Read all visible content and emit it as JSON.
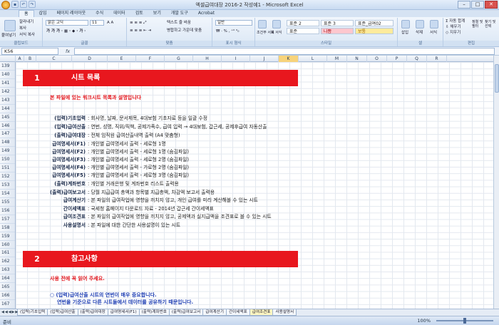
{
  "window": {
    "title": "엑셀급여대장 2016-2 작성예1 - Microsoft Excel"
  },
  "ribbon_tabs": [
    "홈",
    "삽입",
    "페이지 레이아웃",
    "수식",
    "데이터",
    "검토",
    "보기",
    "개발 도구",
    "Acrobat"
  ],
  "ribbon": {
    "clipboard": {
      "paste": "붙여넣기",
      "cut": "잘라내기",
      "copy": "복사",
      "format_painter": "서식 복사",
      "label": "클립보드"
    },
    "font": {
      "name": "맑은 고딕",
      "size": "11",
      "label": "글꼴"
    },
    "alignment": {
      "wrap": "텍스트 줄 바꿈",
      "merge": "병합하고 가운데 맞춤",
      "label": "맞춤"
    },
    "number": {
      "format": "일반",
      "label": "표시 형식"
    },
    "styles": {
      "cond": "조건부 서식",
      "table": "표 서식",
      "s1": "표준 2",
      "s2": "표준 3",
      "s3": "표준_급여02",
      "s4": "표준",
      "s5": "나쁨",
      "s6": "보통",
      "label": "스타일"
    },
    "cells": {
      "insert": "삽입",
      "delete": "삭제",
      "format": "서식",
      "label": "셀"
    },
    "editing": {
      "autosum": "자동 합계",
      "fill": "채우기",
      "clear": "지우기",
      "sort": "정렬 및 필터",
      "find": "찾기 및 선택",
      "label": "편집"
    }
  },
  "formula_bar": {
    "cell_ref": "K56",
    "fx": "fx"
  },
  "columns": [
    "A",
    "B",
    "C",
    "D",
    "E",
    "F",
    "G",
    "H",
    "I",
    "J",
    "K",
    "L",
    "M",
    "N",
    "O",
    "P",
    "Q",
    "R"
  ],
  "selected_column": "K",
  "rows": [
    "139",
    "140",
    "141",
    "142",
    "143",
    "144",
    "145",
    "146",
    "147",
    "148",
    "149",
    "150",
    "151",
    "152",
    "153",
    "154",
    "155",
    "156",
    "157",
    "158",
    "159",
    "160",
    "161",
    "162",
    "163",
    "164",
    "165",
    "166",
    "167"
  ],
  "section1": {
    "number": "1",
    "title": "시트 목록",
    "subtitle": "본 파일에 있는 워크시트 목록과 설명입니다"
  },
  "sheet_list": [
    {
      "label": "(입력)기초입력",
      "desc": ": 회사명, 날짜, 문서제목, 4대보험 기초자료 등을 일괄 수정"
    },
    {
      "label": "(입력)급여산출",
      "desc": ": 연번, 성명, 직위/직책, 공제가족수, 급여 입력 → 4대보험, 갑근세, 공제후급여 자동산출"
    },
    {
      "label": "(출력)급여대장",
      "desc": ": 전체 임직원 급여산출내역 출력 (A4 맞춤형)"
    },
    {
      "label": "급여명세서(F1)",
      "desc": ": 개인별 급여명세서 출력 - 세로형 1명"
    },
    {
      "label": "급여명세서(F2)",
      "desc": ": 개인별 급여명세서 출력 - 세로형 1명       (숨김파일)"
    },
    {
      "label": "급여명세서(F3)",
      "desc": ": 개인별 급여명세서 출력 - 세로형 2명       (숨김파일)"
    },
    {
      "label": "급여명세서(F4)",
      "desc": ": 개인별 급여명세서 출력 - 가로형 2명       (숨김파일)"
    },
    {
      "label": "급여명세서(F5)",
      "desc": ": 개인별 급여명세서 출력 - 세로형 3명       (숨김파일)"
    },
    {
      "label": "(출력)계좌번호",
      "desc": ": 개인별 거래은행 및 계좌번호 리스트 출력용"
    },
    {
      "label": "(출력)급여보고서",
      "desc": ": 당월 지급급여 총액과 항목별 지급총액, 차감액 보고서 출력용"
    },
    {
      "label": "급여계산기",
      "desc": ": 본 파일의 급여작업에 영향을 끼치지 않고, 개인 급여를 미리 계산해볼 수 있는 시트"
    },
    {
      "label": "간이세액표",
      "desc": ": 국세청 홈페이지 다운로드 자료 - 2014년 갑근세 간이세액표"
    },
    {
      "label": "급여조견표",
      "desc": ": 본 파일의 급여작업에 영향을 끼치지 않고, 공제액과 실지급액을 조견표로 볼 수 있는 시트"
    },
    {
      "label": "사용설명서",
      "desc": ": 본 파일에 대한 간단한 사용설명이 있는 시트"
    }
  ],
  "section2": {
    "number": "2",
    "title": "참고사항",
    "subtitle": "사용 전에 꼭 읽어 주세요.",
    "note1": "○ (입력)급여산출 시트의 연번이 매우 중요합니다.",
    "note2": "연번을 기준으로 다른 시트들에서 데이터를 공유하기 때문입니다."
  },
  "sheet_tabs": [
    "(입력)기초입력",
    "(입력)급여산출",
    "(출력)급여대장",
    "급여명세서(F1)",
    "(출력)계좌번호",
    "(출력)급여보고서",
    "급여계산기",
    "간이세액표",
    "급여조견표",
    "사용설명서"
  ],
  "active_sheet": "급여조견표",
  "status": {
    "ready": "준비",
    "zoom": "100%"
  },
  "colors": {
    "accent_red": "#e8171e",
    "text_blue": "#1f3fb3"
  }
}
